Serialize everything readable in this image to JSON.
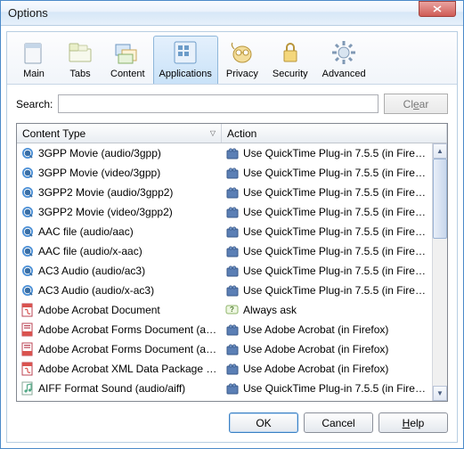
{
  "window": {
    "title": "Options"
  },
  "toolbar": {
    "items": [
      {
        "label": "Main"
      },
      {
        "label": "Tabs"
      },
      {
        "label": "Content"
      },
      {
        "label": "Applications",
        "selected": true
      },
      {
        "label": "Privacy"
      },
      {
        "label": "Security"
      },
      {
        "label": "Advanced"
      }
    ]
  },
  "search": {
    "label": "Search:",
    "value": "",
    "placeholder": "",
    "clear_label": "Clear"
  },
  "columns": {
    "content_type": "Content Type",
    "action": "Action"
  },
  "rows": [
    {
      "icon": "qt",
      "type": "3GPP Movie (audio/3gpp)",
      "aicon": "lego",
      "action": "Use QuickTime Plug-in 7.5.5 (in Firef…"
    },
    {
      "icon": "qt",
      "type": "3GPP Movie (video/3gpp)",
      "aicon": "lego",
      "action": "Use QuickTime Plug-in 7.5.5 (in Firef…"
    },
    {
      "icon": "qt",
      "type": "3GPP2 Movie (audio/3gpp2)",
      "aicon": "lego",
      "action": "Use QuickTime Plug-in 7.5.5 (in Firef…"
    },
    {
      "icon": "qt",
      "type": "3GPP2 Movie (video/3gpp2)",
      "aicon": "lego",
      "action": "Use QuickTime Plug-in 7.5.5 (in Firef…"
    },
    {
      "icon": "qt",
      "type": "AAC file (audio/aac)",
      "aicon": "lego",
      "action": "Use QuickTime Plug-in 7.5.5 (in Firef…"
    },
    {
      "icon": "qt",
      "type": "AAC file (audio/x-aac)",
      "aicon": "lego",
      "action": "Use QuickTime Plug-in 7.5.5 (in Firef…"
    },
    {
      "icon": "qt",
      "type": "AC3 Audio (audio/ac3)",
      "aicon": "lego",
      "action": "Use QuickTime Plug-in 7.5.5 (in Firef…"
    },
    {
      "icon": "qt",
      "type": "AC3 Audio (audio/x-ac3)",
      "aicon": "lego",
      "action": "Use QuickTime Plug-in 7.5.5 (in Firef…"
    },
    {
      "icon": "pdf",
      "type": "Adobe Acrobat Document",
      "aicon": "ask",
      "action": "Always ask"
    },
    {
      "icon": "pdfo",
      "type": "Adobe Acrobat Forms Document (a…",
      "aicon": "lego",
      "action": "Use Adobe Acrobat (in Firefox)"
    },
    {
      "icon": "pdfo",
      "type": "Adobe Acrobat Forms Document (a…",
      "aicon": "lego",
      "action": "Use Adobe Acrobat (in Firefox)"
    },
    {
      "icon": "pdf",
      "type": "Adobe Acrobat XML Data Package File",
      "aicon": "lego",
      "action": "Use Adobe Acrobat (in Firefox)"
    },
    {
      "icon": "aud",
      "type": "AIFF Format Sound (audio/aiff)",
      "aicon": "lego",
      "action": "Use QuickTime Plug-in 7.5.5 (in Firef…"
    }
  ],
  "buttons": {
    "ok": "OK",
    "cancel": "Cancel",
    "help": "Help"
  }
}
